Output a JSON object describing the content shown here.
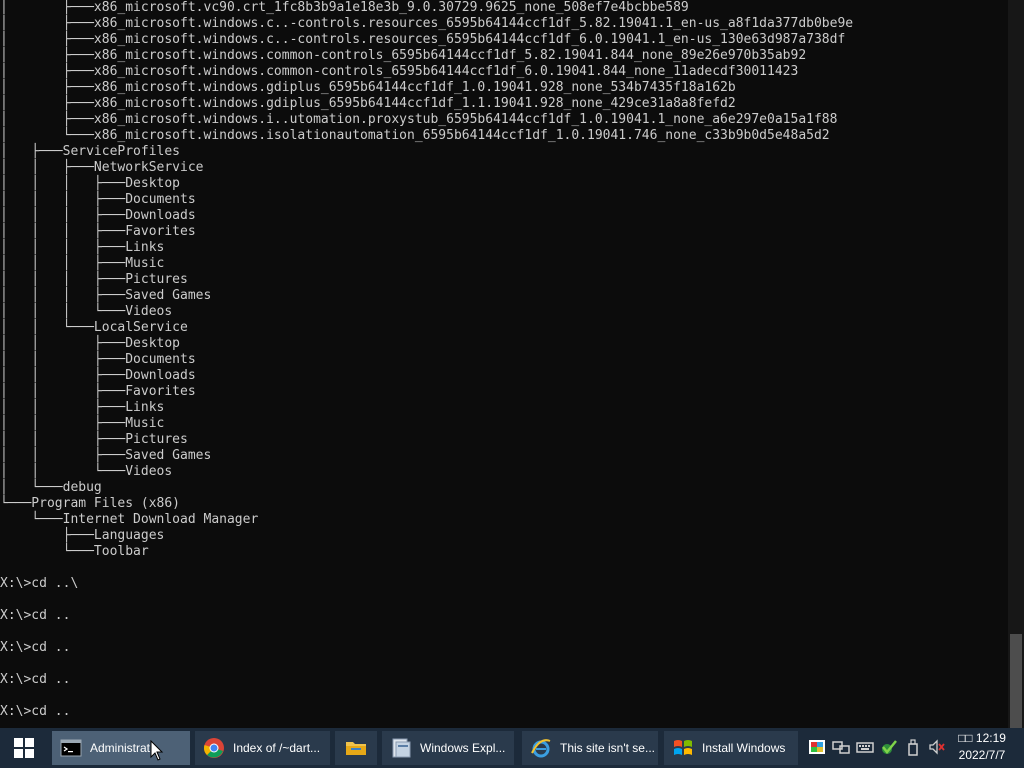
{
  "console": {
    "lines": [
      "│       ├───x86_microsoft.vc90.crt_1fc8b3b9a1e18e3b_9.0.30729.9625_none_508ef7e4bcbbe589",
      "│       ├───x86_microsoft.windows.c..-controls.resources_6595b64144ccf1df_5.82.19041.1_en-us_a8f1da377db0be9e",
      "│       ├───x86_microsoft.windows.c..-controls.resources_6595b64144ccf1df_6.0.19041.1_en-us_130e63d987a738df",
      "│       ├───x86_microsoft.windows.common-controls_6595b64144ccf1df_5.82.19041.844_none_89e26e970b35ab92",
      "│       ├───x86_microsoft.windows.common-controls_6595b64144ccf1df_6.0.19041.844_none_11adecdf30011423",
      "│       ├───x86_microsoft.windows.gdiplus_6595b64144ccf1df_1.0.19041.928_none_534b7435f18a162b",
      "│       ├───x86_microsoft.windows.gdiplus_6595b64144ccf1df_1.1.19041.928_none_429ce31a8a8fefd2",
      "│       ├───x86_microsoft.windows.i..utomation.proxystub_6595b64144ccf1df_1.0.19041.1_none_a6e297e0a15a1f88",
      "│       └───x86_microsoft.windows.isolationautomation_6595b64144ccf1df_1.0.19041.746_none_c33b9b0d5e48a5d2",
      "│   ├───ServiceProfiles",
      "│   │   ├───NetworkService",
      "│   │   │   ├───Desktop",
      "│   │   │   ├───Documents",
      "│   │   │   ├───Downloads",
      "│   │   │   ├───Favorites",
      "│   │   │   ├───Links",
      "│   │   │   ├───Music",
      "│   │   │   ├───Pictures",
      "│   │   │   ├───Saved Games",
      "│   │   │   └───Videos",
      "│   │   └───LocalService",
      "│   │       ├───Desktop",
      "│   │       ├───Documents",
      "│   │       ├───Downloads",
      "│   │       ├───Favorites",
      "│   │       ├───Links",
      "│   │       ├───Music",
      "│   │       ├───Pictures",
      "│   │       ├───Saved Games",
      "│   │       └───Videos",
      "│   └───debug",
      "└───Program Files (x86)",
      "    └───Internet Download Manager",
      "        ├───Languages",
      "        └───Toolbar",
      "",
      "X:\\>cd ..\\",
      "",
      "X:\\>cd ..",
      "",
      "X:\\>cd ..",
      "",
      "X:\\>cd ..",
      "",
      "X:\\>cd .."
    ]
  },
  "taskbar": {
    "buttons": [
      {
        "label": "Administrat...",
        "icon": "cmd-icon",
        "active": true
      },
      {
        "label": "Index of /~dart...",
        "icon": "chrome-icon",
        "active": false
      },
      {
        "label": "",
        "icon": "folder-icon",
        "active": false
      },
      {
        "label": "Windows Expl...",
        "icon": "windows-explorer-icon",
        "active": false
      },
      {
        "label": "This site isn't se...",
        "icon": "ie-icon",
        "active": false
      },
      {
        "label": "Install Windows",
        "icon": "windows-setup-icon",
        "active": false
      }
    ],
    "tray": {
      "icons": [
        "color-icon",
        "network-icon",
        "keyboard-icon",
        "checkmark-icon",
        "usb-icon",
        "volume-muted-icon"
      ],
      "clock_time": "□□ 12:19",
      "clock_date": "2022/7/7"
    }
  },
  "colors": {
    "console_bg": "#0c0c0c",
    "console_text": "#cccccc",
    "taskbar_bg": "#1c2a3a",
    "active_button": "#4d6176"
  }
}
